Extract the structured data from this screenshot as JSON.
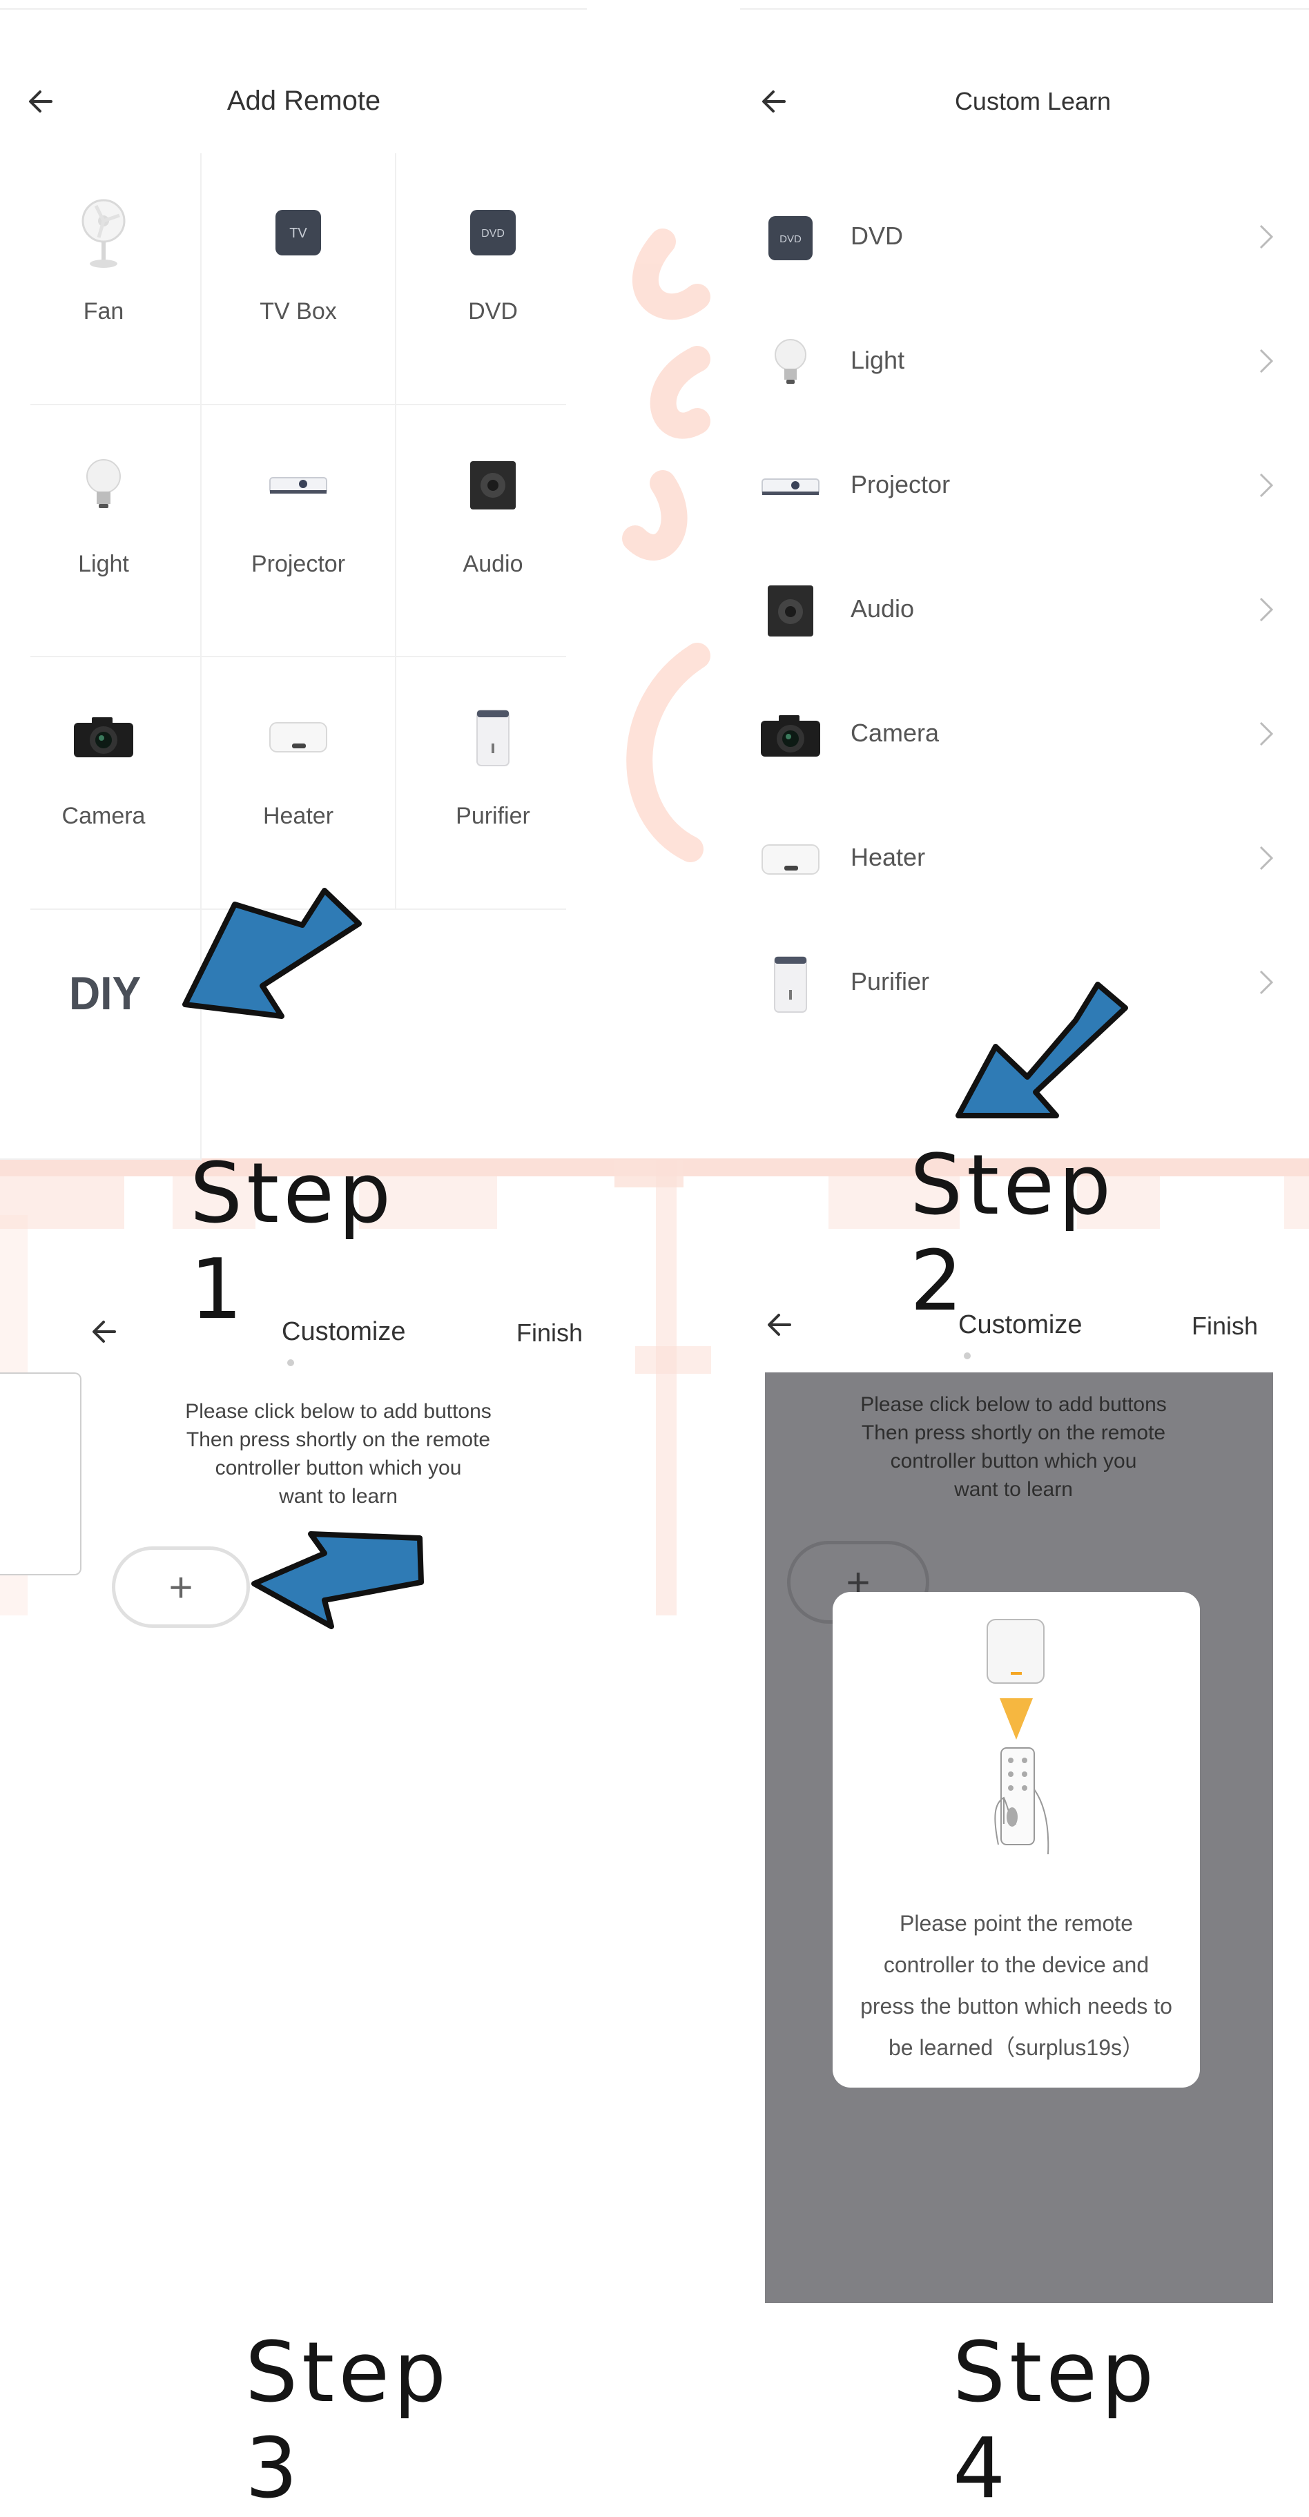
{
  "step1": {
    "title": "Add Remote",
    "grid": [
      {
        "label": "Fan",
        "icon": "fan-icon"
      },
      {
        "label": "TV Box",
        "icon": "tv-box-icon",
        "icon_text": "TV"
      },
      {
        "label": "DVD",
        "icon": "dvd-icon",
        "icon_text": "DVD"
      },
      {
        "label": "Light",
        "icon": "light-bulb-icon"
      },
      {
        "label": "Projector",
        "icon": "projector-icon"
      },
      {
        "label": "Audio",
        "icon": "speaker-icon"
      },
      {
        "label": "Camera",
        "icon": "camera-icon"
      },
      {
        "label": "Heater",
        "icon": "heater-icon"
      },
      {
        "label": "Purifier",
        "icon": "purifier-icon"
      }
    ],
    "diy_label": "DIY",
    "step_label": "Step 1"
  },
  "step2": {
    "title": "Custom Learn",
    "items": [
      {
        "label": "DVD",
        "icon": "dvd-icon",
        "icon_text": "DVD"
      },
      {
        "label": "Light",
        "icon": "light-bulb-icon"
      },
      {
        "label": "Projector",
        "icon": "projector-icon"
      },
      {
        "label": "Audio",
        "icon": "speaker-icon"
      },
      {
        "label": "Camera",
        "icon": "camera-icon"
      },
      {
        "label": "Heater",
        "icon": "heater-icon"
      },
      {
        "label": "Purifier",
        "icon": "purifier-icon"
      }
    ],
    "step_label": "Step 2"
  },
  "step3": {
    "title": "Customize",
    "finish_label": "Finish",
    "instructions": [
      "Please click below to add buttons",
      "Then press shortly on the remote",
      "controller button which you",
      "want to learn"
    ],
    "add_symbol": "+",
    "step_label": "Step 3"
  },
  "step4": {
    "title": "Customize",
    "finish_label": "Finish",
    "instructions": [
      "Please click below to add buttons",
      "Then press shortly on the remote",
      "controller button which you",
      "want to learn"
    ],
    "add_symbol": "+",
    "dialog_lines": [
      "Please point the remote",
      "controller to the device and",
      "press the button which needs to",
      "be learned（surplus19s）"
    ],
    "step_label": "Step 4"
  },
  "colors": {
    "arrow": "#2f7bb5",
    "overlay": "#808084",
    "deco": "#fbd9cf",
    "accent": "#f5a623"
  }
}
